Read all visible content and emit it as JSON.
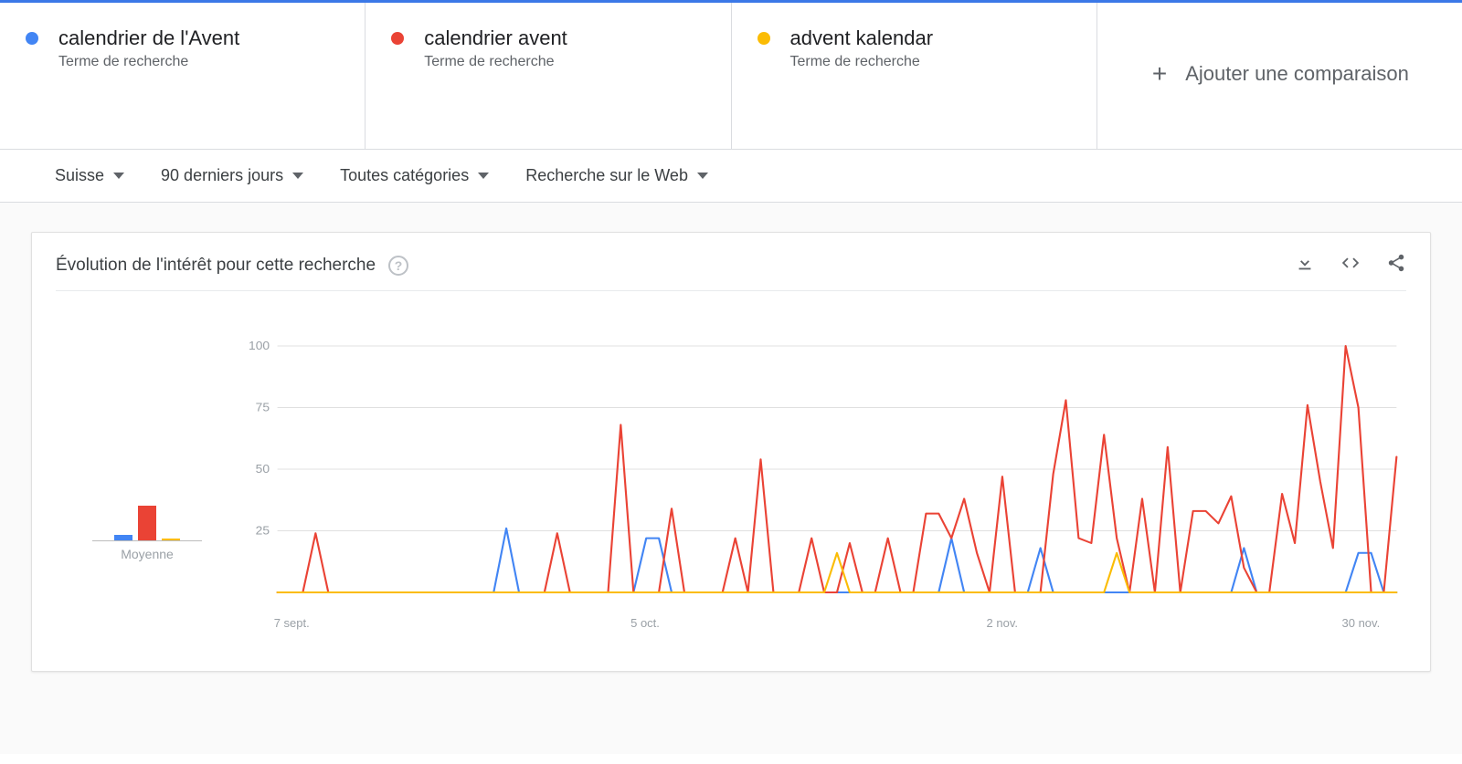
{
  "colors": {
    "blue": "#4285f4",
    "red": "#ea4335",
    "yellow": "#fbbc04",
    "grey": "#5f6368"
  },
  "compare": {
    "terms": [
      {
        "label": "calendrier de l'Avent",
        "subtype": "Terme de recherche",
        "color": "#4285f4"
      },
      {
        "label": "calendrier avent",
        "subtype": "Terme de recherche",
        "color": "#ea4335"
      },
      {
        "label": "advent kalendar",
        "subtype": "Terme de recherche",
        "color": "#fbbc04"
      }
    ],
    "add_label": "Ajouter une comparaison"
  },
  "filters": {
    "geo": "Suisse",
    "range": "90 derniers jours",
    "cat": "Toutes catégories",
    "search": "Recherche sur le Web"
  },
  "chart": {
    "title": "Évolution de l'intérêt pour cette recherche",
    "avg_label": "Moyenne",
    "help_glyph": "?"
  },
  "chart_data": {
    "type": "line",
    "title": "Évolution de l'intérêt pour cette recherche",
    "xlabel": "",
    "ylabel": "",
    "ylim": [
      0,
      100
    ],
    "yticks": [
      25,
      50,
      75,
      100
    ],
    "xticks_positions": [
      0,
      28,
      56,
      84
    ],
    "xticks_labels": [
      "7 sept.",
      "5 oct.",
      "2 nov.",
      "30 nov."
    ],
    "x": [
      0,
      1,
      2,
      3,
      4,
      5,
      6,
      7,
      8,
      9,
      10,
      11,
      12,
      13,
      14,
      15,
      16,
      17,
      18,
      19,
      20,
      21,
      22,
      23,
      24,
      25,
      26,
      27,
      28,
      29,
      30,
      31,
      32,
      33,
      34,
      35,
      36,
      37,
      38,
      39,
      40,
      41,
      42,
      43,
      44,
      45,
      46,
      47,
      48,
      49,
      50,
      51,
      52,
      53,
      54,
      55,
      56,
      57,
      58,
      59,
      60,
      61,
      62,
      63,
      64,
      65,
      66,
      67,
      68,
      69,
      70,
      71,
      72,
      73,
      74,
      75,
      76,
      77,
      78,
      79,
      80,
      81,
      82,
      83,
      84,
      85,
      86,
      87,
      88
    ],
    "series": [
      {
        "name": "calendrier de l'Avent",
        "color": "#4285f4",
        "values": [
          0,
          0,
          0,
          0,
          0,
          0,
          0,
          0,
          0,
          0,
          0,
          0,
          0,
          0,
          0,
          0,
          0,
          0,
          26,
          0,
          0,
          0,
          0,
          0,
          0,
          0,
          0,
          0,
          0,
          22,
          22,
          0,
          0,
          0,
          0,
          0,
          0,
          0,
          0,
          0,
          0,
          0,
          0,
          0,
          0,
          0,
          0,
          0,
          0,
          0,
          0,
          0,
          0,
          22,
          0,
          0,
          0,
          0,
          0,
          0,
          18,
          0,
          0,
          0,
          0,
          0,
          0,
          0,
          0,
          0,
          0,
          0,
          0,
          0,
          0,
          0,
          18,
          0,
          0,
          0,
          0,
          0,
          0,
          0,
          0,
          16,
          16,
          0,
          0
        ]
      },
      {
        "name": "calendrier avent",
        "color": "#ea4335",
        "values": [
          0,
          0,
          0,
          24,
          0,
          0,
          0,
          0,
          0,
          0,
          0,
          0,
          0,
          0,
          0,
          0,
          0,
          0,
          0,
          0,
          0,
          0,
          24,
          0,
          0,
          0,
          0,
          68,
          0,
          0,
          0,
          34,
          0,
          0,
          0,
          0,
          22,
          0,
          54,
          0,
          0,
          0,
          22,
          0,
          0,
          20,
          0,
          0,
          22,
          0,
          0,
          32,
          32,
          22,
          38,
          16,
          0,
          47,
          0,
          0,
          0,
          48,
          78,
          22,
          20,
          64,
          22,
          0,
          38,
          0,
          59,
          0,
          33,
          33,
          28,
          39,
          10,
          0,
          0,
          40,
          20,
          76,
          45,
          18,
          100,
          75,
          0,
          0,
          55
        ]
      },
      {
        "name": "advent kalendar",
        "color": "#fbbc04",
        "values": [
          0,
          0,
          0,
          0,
          0,
          0,
          0,
          0,
          0,
          0,
          0,
          0,
          0,
          0,
          0,
          0,
          0,
          0,
          0,
          0,
          0,
          0,
          0,
          0,
          0,
          0,
          0,
          0,
          0,
          0,
          0,
          0,
          0,
          0,
          0,
          0,
          0,
          0,
          0,
          0,
          0,
          0,
          0,
          0,
          16,
          0,
          0,
          0,
          0,
          0,
          0,
          0,
          0,
          0,
          0,
          0,
          0,
          0,
          0,
          0,
          0,
          0,
          0,
          0,
          0,
          0,
          16,
          0,
          0,
          0,
          0,
          0,
          0,
          0,
          0,
          0,
          0,
          0,
          0,
          0,
          0,
          0,
          0,
          0,
          0,
          0,
          0,
          0,
          0
        ]
      }
    ],
    "averages": [
      {
        "name": "calendrier de l'Avent",
        "color": "#4285f4",
        "value": 3
      },
      {
        "name": "calendrier avent",
        "color": "#ea4335",
        "value": 19
      },
      {
        "name": "advent kalendar",
        "color": "#fbbc04",
        "value": 0
      }
    ]
  }
}
